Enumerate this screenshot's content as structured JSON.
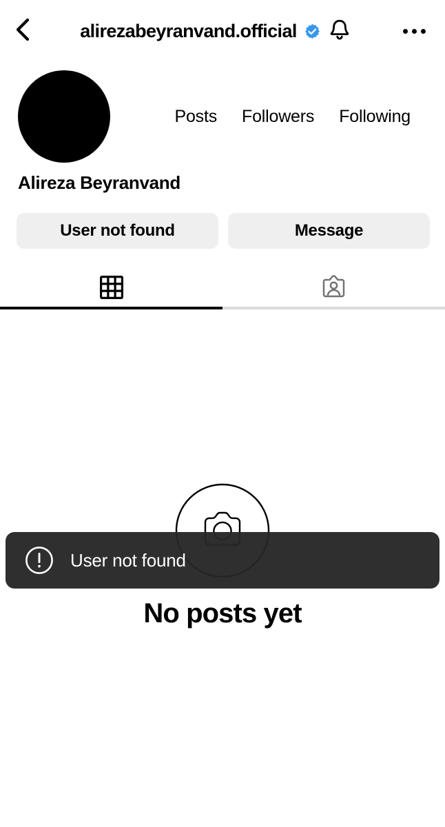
{
  "header": {
    "back_icon": "chevron-left-icon",
    "username": "alirezabeyranvand.official",
    "verified_icon": "verified-badge-icon",
    "verified_color": "#3797F0",
    "bell_icon": "bell-icon",
    "menu_icon": "three-dots-icon"
  },
  "profile": {
    "avatar_color": "#000000",
    "display_name": "Alireza Beyranvand",
    "stats": [
      {
        "label": "Posts",
        "value": ""
      },
      {
        "label": "Followers",
        "value": ""
      },
      {
        "label": "Following",
        "value": ""
      }
    ]
  },
  "actions": {
    "primary_label": "User not found",
    "secondary_label": "Message",
    "button_bg": "#efefef"
  },
  "tabs": [
    {
      "name": "grid",
      "icon": "grid-icon",
      "active": true
    },
    {
      "name": "tagged",
      "icon": "tagged-person-icon",
      "active": false
    }
  ],
  "empty_state": {
    "icon": "camera-circle-icon",
    "title": "No posts yet"
  },
  "toast": {
    "icon": "exclamation-circle-icon",
    "message": "User not found",
    "bg_color": "#262626",
    "text_color": "#ffffff"
  }
}
